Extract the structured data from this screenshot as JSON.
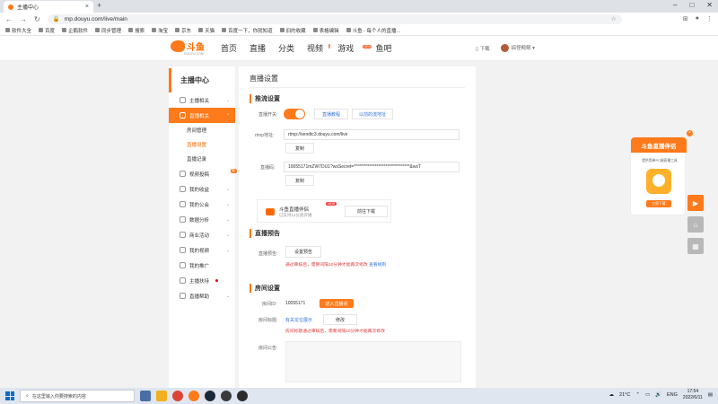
{
  "browser": {
    "tab_title": "主播中心",
    "url": "mp.douyu.com/live/main",
    "window_controls": [
      "–",
      "□",
      "✕"
    ],
    "bookmarks": [
      "软件大全",
      "百度",
      "企鹅软件",
      "同步管理",
      "搜索",
      "淘宝",
      "京东",
      "天猫",
      "百度一下，你就知道",
      "旧的收藏",
      "表格编辑",
      "斗鱼 - 每个人的直播..."
    ]
  },
  "site": {
    "logo_text": "斗鱼",
    "logo_sub": "DOUYU.COM",
    "nav": [
      "首页",
      "直播",
      "分类",
      "视频",
      "游戏",
      "鱼吧"
    ],
    "nav_video_badge": "1",
    "nav_game_badge": "NEW",
    "download": "下载",
    "username": "搞怪鲸鲸"
  },
  "sidebar": {
    "title": "主播中心",
    "items": [
      {
        "label": "主播相关"
      },
      {
        "label": "直播相关"
      },
      {
        "label": "房间管理"
      },
      {
        "label": "直播设置"
      },
      {
        "label": "直播记录"
      },
      {
        "label": "视频投稿",
        "tag": "新"
      },
      {
        "label": "我的收益"
      },
      {
        "label": "我的公会"
      },
      {
        "label": "数据分析"
      },
      {
        "label": "商业活动"
      },
      {
        "label": "我的视频"
      },
      {
        "label": "我的推广"
      },
      {
        "label": "主播扶持"
      },
      {
        "label": "直播帮助"
      }
    ]
  },
  "main": {
    "page_title": "直播设置",
    "push": {
      "section_title": "推流设置",
      "switch_label": "直播开关:",
      "link1": "直播教程",
      "link2": "以前的流地址",
      "rtmp_label": "rtmp地址:",
      "rtmp_value": "rtmp://sendtc3.douyu.com/live",
      "copy1": "复制",
      "code_label": "直播码:",
      "code_value": "10055171mZW7DU1?wsSecret=********************************&wsT",
      "copy2": "复制"
    },
    "promo": {
      "title": "斗鱼直播伴侣",
      "sub": "已支持12分类开播",
      "new": "NEW",
      "button": "前往下载"
    },
    "notice": {
      "section_title": "直播预告",
      "label": "直播预告:",
      "button": "设置预告",
      "warning": "通过审核后，需要间隔10分钟才能再次修改",
      "link": "查看规则"
    },
    "room": {
      "section_title": "房间设置",
      "id_label": "房间ID:",
      "id_value": "10055171",
      "enter_btn": "进入直播间",
      "title_label": "房间标题:",
      "title_value": "有关龙位展示",
      "edit_btn": "修改",
      "title_warning": "房间标题通过审核后，需要间隔10分钟才能再次修改",
      "announce_label": "房间公告:"
    }
  },
  "ad": {
    "header": "斗鱼直播伴侣",
    "desc": "提供简单PC端直播工具",
    "app_name": "DOUYU",
    "button": "立即下载"
  },
  "taskbar": {
    "search_placeholder": "在这里输入你要搜索的内容",
    "weather": "21°C",
    "lang": "ENG",
    "time": "17:54",
    "date": "2022/6/11"
  }
}
